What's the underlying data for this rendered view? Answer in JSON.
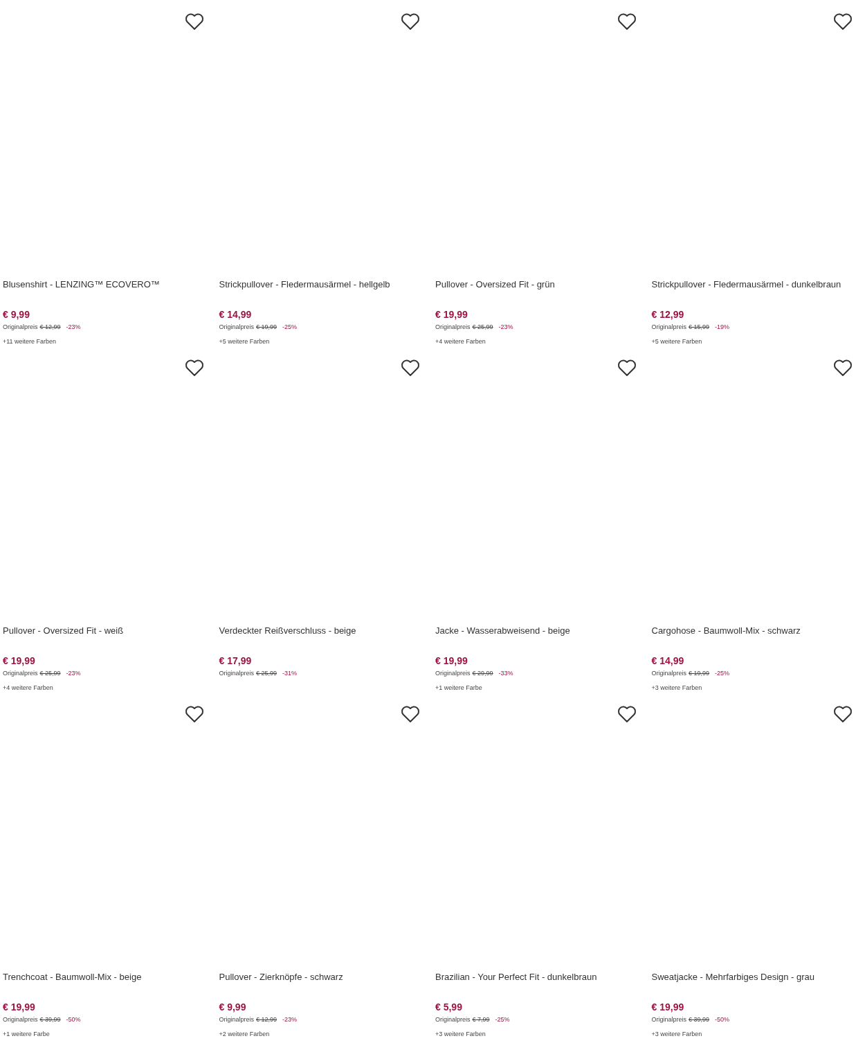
{
  "products": [
    {
      "title": "Blusenshirt - LENZING™ ECOVERO™",
      "price": "€ 9,99",
      "original_label": "Originalpreis",
      "original_price": "€ 12,99",
      "discount": "-23%",
      "colors": "+11 weitere Farben"
    },
    {
      "title": "Strickpullover - Fledermausärmel - hellgelb",
      "price": "€ 14,99",
      "original_label": "Originalpreis",
      "original_price": "€ 19,99",
      "discount": "-25%",
      "colors": "+5 weitere Farben"
    },
    {
      "title": "Pullover - Oversized Fit - grün",
      "price": "€ 19,99",
      "original_label": "Originalpreis",
      "original_price": "€ 25,99",
      "discount": "-23%",
      "colors": "+4 weitere Farben"
    },
    {
      "title": "Strickpullover - Fledermausärmel - dunkelbraun",
      "price": "€ 12,99",
      "original_label": "Originalpreis",
      "original_price": "€ 15,99",
      "discount": "-19%",
      "colors": "+5 weitere Farben"
    },
    {
      "title": "Pullover - Oversized Fit - weiß",
      "price": "€ 19,99",
      "original_label": "Originalpreis",
      "original_price": "€ 25,99",
      "discount": "-23%",
      "colors": "+4 weitere Farben"
    },
    {
      "title": "Verdeckter Reißverschluss - beige",
      "price": "€ 17,99",
      "original_label": "Originalpreis",
      "original_price": "€ 25,99",
      "discount": "-31%"
    },
    {
      "title": "Jacke - Wasserabweisend - beige",
      "price": "€ 19,99",
      "original_label": "Originalpreis",
      "original_price": "€ 29,99",
      "discount": "-33%",
      "colors": "+1 weitere Farbe"
    },
    {
      "title": "Cargohose - Baumwoll-Mix - schwarz",
      "price": "€ 14,99",
      "original_label": "Originalpreis",
      "original_price": "€ 19,99",
      "discount": "-25%",
      "colors": "+3 weitere Farben"
    },
    {
      "title": "Trenchcoat - Baumwoll-Mix - beige",
      "price": "€ 19,99",
      "original_label": "Originalpreis",
      "original_price": "€ 39,99",
      "discount": "-50%",
      "colors": "+1 weitere Farbe"
    },
    {
      "title": "Pullover - Zierknöpfe - schwarz",
      "price": "€ 9,99",
      "original_label": "Originalpreis",
      "original_price": "€ 12,99",
      "discount": "-23%",
      "colors": "+2 weitere Farben"
    },
    {
      "title": "Brazilian - Your Perfect Fit - dunkelbraun",
      "price": "€ 5,99",
      "original_label": "Originalpreis",
      "original_price": "€ 7,99",
      "discount": "-25%",
      "colors": "+3 weitere Farben"
    },
    {
      "title": "Sweatjacke - Mehrfarbiges Design - grau",
      "price": "€ 19,99",
      "original_label": "Originalpreis",
      "original_price": "€ 39,99",
      "discount": "-50%",
      "colors": "+3 weitere Farben"
    }
  ]
}
